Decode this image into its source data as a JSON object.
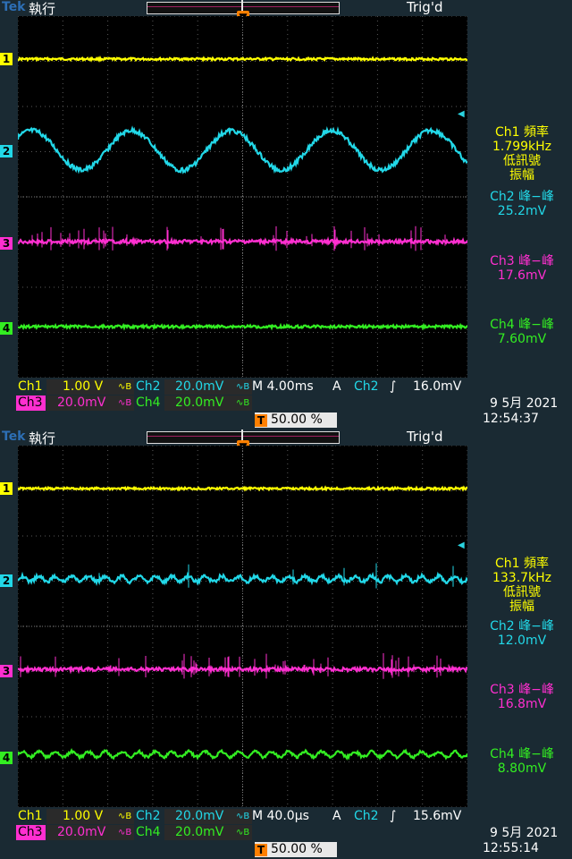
{
  "brand": "Tek",
  "colors": {
    "ch1": "#ffff00",
    "ch2": "#22d8e8",
    "ch3": "#ff2fd0",
    "ch4": "#33ee22",
    "trigger": "#ff8000",
    "status_bg": "#1a2a33"
  },
  "panels": [
    {
      "status": "執行",
      "trig_state": "Trig'd",
      "markers": [
        "1",
        "2",
        "3",
        "4"
      ],
      "meas": {
        "ch1_label": "Ch1 頻率",
        "ch1_value": "1.799kHz",
        "ch1_note1": "低訊號",
        "ch1_note2": "振幅",
        "ch2_label": "Ch2 峰−峰",
        "ch2_value": "25.2mV",
        "ch3_label": "Ch3 峰−峰",
        "ch3_value": "17.6mV",
        "ch4_label": "Ch4 峰−峰",
        "ch4_value": "7.60mV"
      },
      "info": {
        "ch1": "Ch1",
        "ch1_scale": "1.00 V",
        "ch1_bw": "∿B",
        "ch2": "Ch2",
        "ch2_scale": "20.0mV",
        "ch2_bw": "∿B",
        "timebase": "M 4.00ms",
        "acq": "A",
        "trig_src": "Ch2",
        "trig_slope": "∫",
        "trig_level": "16.0mV",
        "ch3": "Ch3",
        "ch3_scale": "20.0mV",
        "ch3_bw": "∿B",
        "ch4": "Ch4",
        "ch4_scale": "20.0mV",
        "ch4_bw": "∿B",
        "trig_pos": "50.00 %",
        "date": "9 5月  2021",
        "time": "12:54:37"
      },
      "waveform": {
        "ch2_type": "sine",
        "ch2_cycles": 4.5
      }
    },
    {
      "status": "執行",
      "trig_state": "Trig'd",
      "markers": [
        "1",
        "2",
        "3",
        "4"
      ],
      "meas": {
        "ch1_label": "Ch1 頻率",
        "ch1_value": "133.7kHz",
        "ch1_note1": "低訊號",
        "ch1_note2": "振幅",
        "ch2_label": "Ch2 峰−峰",
        "ch2_value": "12.0mV",
        "ch3_label": "Ch3 峰−峰",
        "ch3_value": "16.8mV",
        "ch4_label": "Ch4 峰−峰",
        "ch4_value": "8.80mV"
      },
      "info": {
        "ch1": "Ch1",
        "ch1_scale": "1.00 V",
        "ch1_bw": "∿B",
        "ch2": "Ch2",
        "ch2_scale": "20.0mV",
        "ch2_bw": "∿B",
        "timebase": "M 40.0µs",
        "acq": "A",
        "trig_src": "Ch2",
        "trig_slope": "∫",
        "trig_level": "15.6mV",
        "ch3": "Ch3",
        "ch3_scale": "20.0mV",
        "ch3_bw": "∿B",
        "ch4": "Ch4",
        "ch4_scale": "20.0mV",
        "ch4_bw": "∿B",
        "trig_pos": "50.00 %",
        "date": "9 5月  2021",
        "time": "12:55:14"
      },
      "waveform": {
        "ch2_type": "ripple",
        "ch2_cycles": 27
      }
    }
  ]
}
